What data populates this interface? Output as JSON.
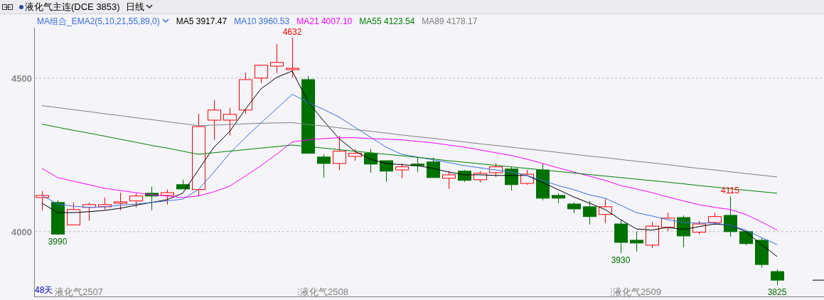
{
  "header": {
    "title": "液化气主连(DCE 3853)",
    "period": "日线"
  },
  "indicator": {
    "name": "MA组合_EMA2(5,10,21,55,89,0)",
    "values": [
      {
        "label": "MA5",
        "value": "3917.47",
        "color": "#000000"
      },
      {
        "label": "MA10",
        "value": "3960.53",
        "color": "#3b6fe0"
      },
      {
        "label": "MA21",
        "value": "4007.10",
        "color": "#ff00ff"
      },
      {
        "label": "MA55",
        "value": "4123.54",
        "color": "#008000"
      },
      {
        "label": "MA89",
        "value": "4178.17",
        "color": "#808080"
      }
    ]
  },
  "price_chart": {
    "y_axis_labels": [
      "4500",
      "4000"
    ],
    "period_count": "48天",
    "x_axis_labels": [
      "液化气2507",
      "液化气2508",
      "液化气2509"
    ],
    "annotations": [
      {
        "kind": "high",
        "text": "4632"
      },
      {
        "kind": "low",
        "text": "3990"
      },
      {
        "kind": "low",
        "text": "3930"
      },
      {
        "kind": "high",
        "text": "4115"
      },
      {
        "kind": "low",
        "text": "3825"
      }
    ]
  }
}
